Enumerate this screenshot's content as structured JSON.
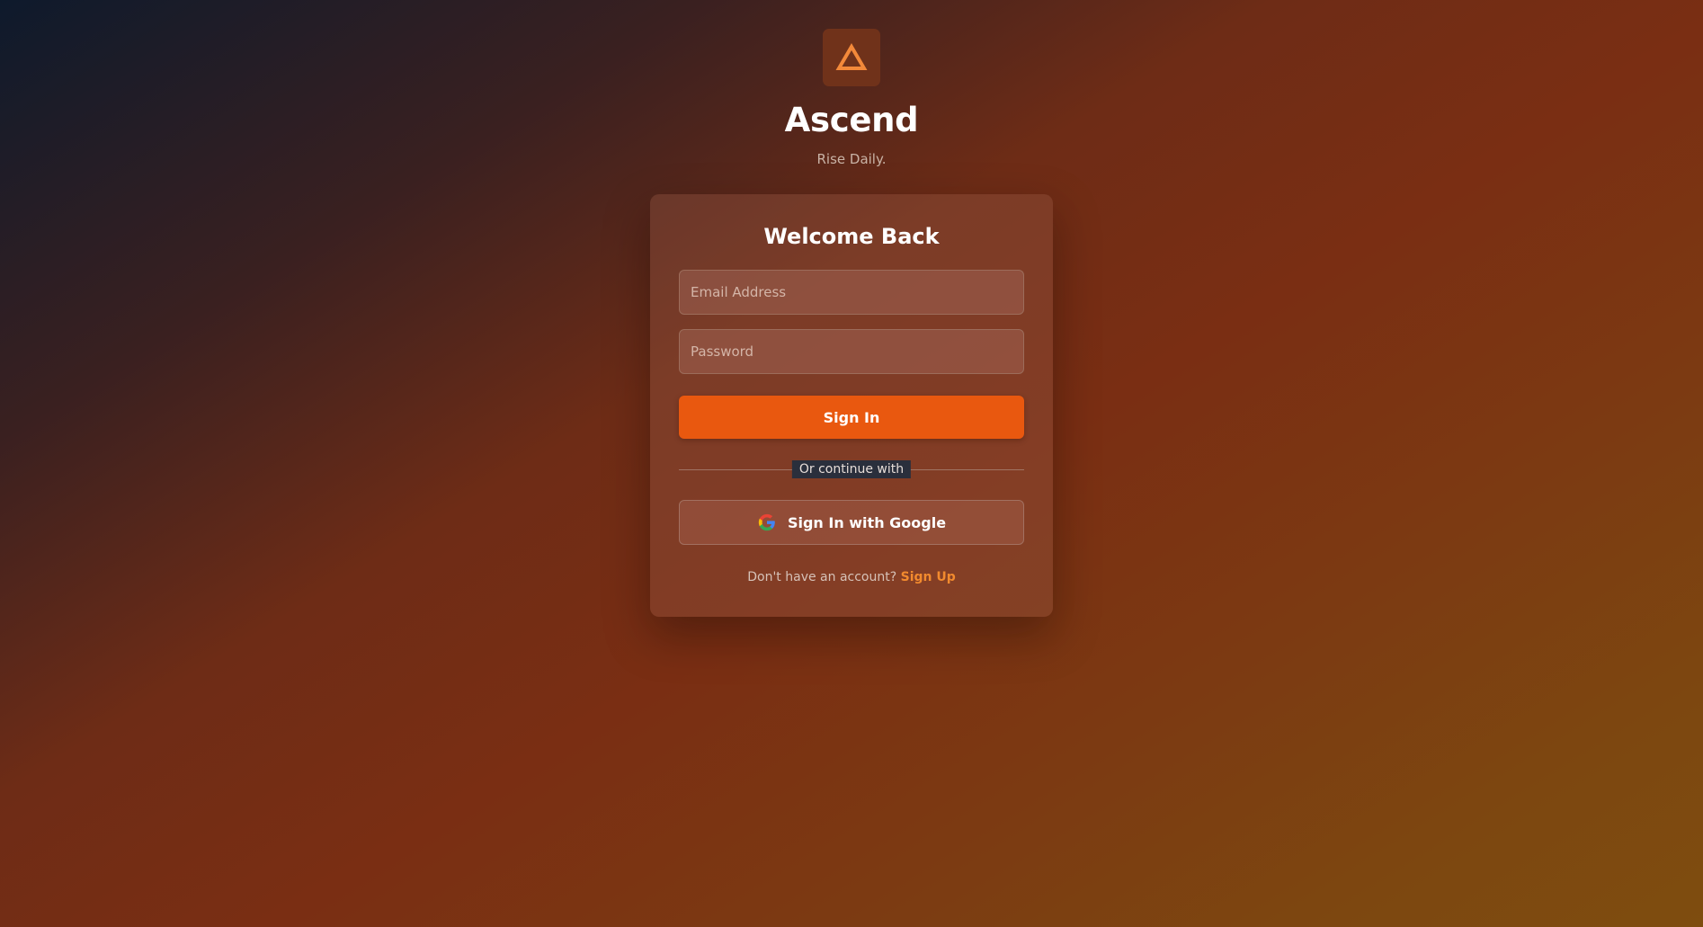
{
  "brand": {
    "logo_icon": "triangle-logo-icon",
    "title": "Ascend",
    "tagline": "Rise Daily."
  },
  "login_card": {
    "heading": "Welcome Back",
    "email_field": {
      "placeholder": "Email Address",
      "value": ""
    },
    "password_field": {
      "placeholder": "Password",
      "value": ""
    },
    "signin_button_label": "Sign In",
    "divider_text": "Or continue with",
    "google_button": {
      "icon": "google-icon",
      "label": "Sign In with Google"
    },
    "signup_prompt": "Don't have an account?",
    "signup_link_label": "Sign Up"
  },
  "colors": {
    "accent": "#e9580f",
    "link": "#f28a2e",
    "logo_stroke": "#f3893a"
  }
}
